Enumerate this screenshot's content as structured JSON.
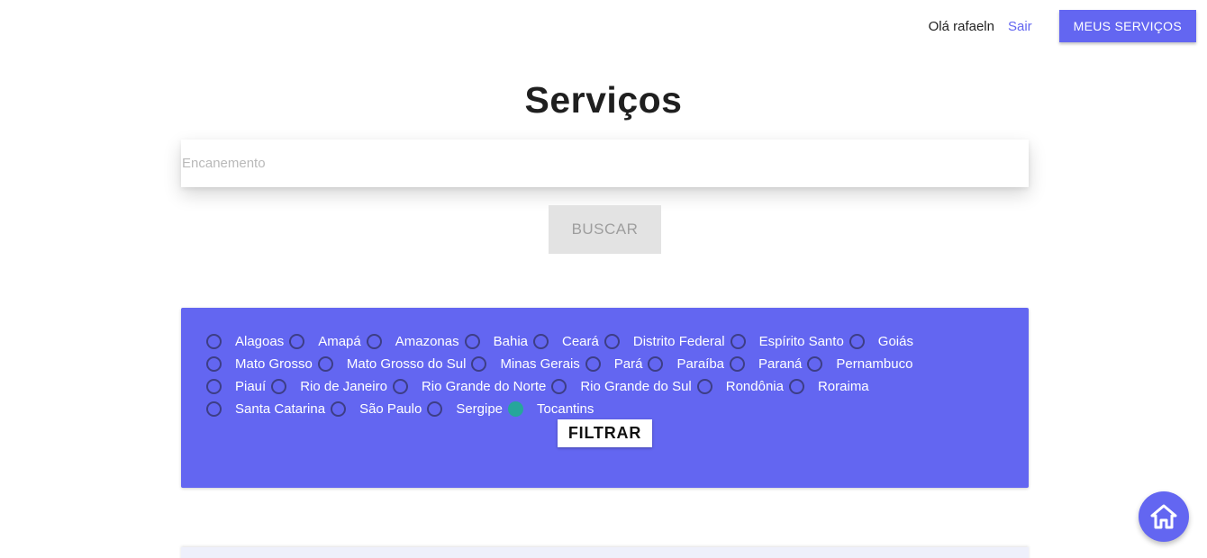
{
  "header": {
    "greeting": "Olá rafaeln",
    "logout_label": "Sair",
    "my_services_label": "MEUS SERVIÇOS"
  },
  "main": {
    "title": "Serviços",
    "search": {
      "placeholder": "Encanemento",
      "value": ""
    },
    "search_button_label": "BUSCAR"
  },
  "filter": {
    "states": [
      {
        "label": "Alagoas",
        "checked": false
      },
      {
        "label": "Amapá",
        "checked": false
      },
      {
        "label": "Amazonas",
        "checked": false
      },
      {
        "label": "Bahia",
        "checked": false
      },
      {
        "label": "Ceará",
        "checked": false
      },
      {
        "label": "Distrito Federal",
        "checked": false
      },
      {
        "label": "Espírito Santo",
        "checked": false
      },
      {
        "label": "Goiás",
        "checked": false
      },
      {
        "label": "Mato Grosso",
        "checked": false
      },
      {
        "label": "Mato Grosso do Sul",
        "checked": false
      },
      {
        "label": "Minas Gerais",
        "checked": false
      },
      {
        "label": "Pará",
        "checked": false
      },
      {
        "label": "Paraíba",
        "checked": false
      },
      {
        "label": "Paraná",
        "checked": false
      },
      {
        "label": "Pernambuco",
        "checked": false
      },
      {
        "label": "Piauí",
        "checked": false
      },
      {
        "label": "Rio de Janeiro",
        "checked": false
      },
      {
        "label": "Rio Grande do Norte",
        "checked": false
      },
      {
        "label": "Rio Grande do Sul",
        "checked": false
      },
      {
        "label": "Rondônia",
        "checked": false
      },
      {
        "label": "Roraima",
        "checked": false
      },
      {
        "label": "Santa Catarina",
        "checked": false
      },
      {
        "label": "São Paulo",
        "checked": false
      },
      {
        "label": "Sergipe",
        "checked": false
      },
      {
        "label": "Tocantins",
        "checked": true
      }
    ],
    "filter_button_label": "FILTRAR"
  },
  "icons": {
    "home": "home-icon"
  },
  "colors": {
    "accent": "#6366f1",
    "radio_checked": "#26a69a",
    "search_button_bg": "#e3e3e3"
  }
}
